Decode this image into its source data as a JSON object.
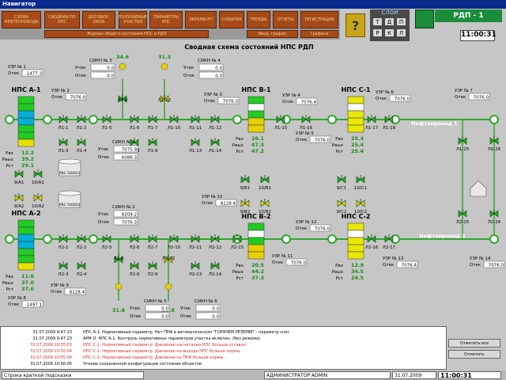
{
  "window": {
    "title": "Навигатор"
  },
  "nav": {
    "top": [
      "СХЕМА НЕФТЕПРОВОДА",
      "СВОДНАЯ ПО НПС",
      "ДОГОВОР. ОКНА",
      "ПОЛУЧАЕМЫЕ УЧАСТКИ",
      "ПАРАМЕТРЫ НПС",
      "ЭКРАНЫ РП",
      "СОБЫТИЯ",
      "ТРЕНДЫ",
      "ОТЧЕТЫ",
      "РЕГИСТРАЦИЯ"
    ],
    "bottom": [
      "Журнал общего состояния НПС и РДП",
      "Ввод. график",
      "Графики"
    ]
  },
  "help": {
    "label": "?"
  },
  "kpanel": {
    "title": "СЛОИ",
    "cells": [
      "Т",
      "Д",
      "П",
      "Р",
      "К",
      "Л"
    ]
  },
  "header": {
    "rdp": "РДП - 1",
    "clock": "11:00:31"
  },
  "schema": {
    "title": "Сводная схема состояний НПС РДП"
  },
  "stations": [
    {
      "name": "НПС А-1",
      "rows": [
        [
          "Рвх",
          "12.2"
        ],
        [
          "Рвых",
          "39.2"
        ],
        [
          "Рст",
          "29.1"
        ]
      ]
    },
    {
      "name": "НПС А-2",
      "rows": [
        [
          "Рвх",
          "11.6"
        ],
        [
          "Рвых",
          "37.0"
        ],
        [
          "Рст",
          "37.0"
        ]
      ]
    },
    {
      "name": "НПС В-1",
      "rows": [
        [
          "Рвх",
          "26.1"
        ],
        [
          "Рвых",
          "47.3"
        ],
        [
          "Рст",
          "47.2"
        ]
      ]
    },
    {
      "name": "НПС В-2",
      "rows": [
        [
          "Рвх",
          "20.5"
        ],
        [
          "Рвых",
          "44.2"
        ],
        [
          "Рст",
          "37.3"
        ]
      ]
    },
    {
      "name": "НПС С-1",
      "rows": [
        [
          "Рвх",
          "25.4"
        ],
        [
          "Рвых",
          "25.4"
        ],
        [
          "Рст",
          "25.4"
        ]
      ]
    },
    {
      "name": "НПС С-2",
      "rows": [
        [
          "Рвх",
          "12.9"
        ],
        [
          "Рвых",
          "34.5"
        ],
        [
          "Рст",
          "24.5"
        ]
      ]
    }
  ],
  "uzr": [
    {
      "name": "УЗР № 1",
      "val": "1477.3"
    },
    {
      "name": "УЗР № 2",
      "val": "7076.0"
    },
    {
      "name": "УЗР № 3",
      "val": "7076.3"
    },
    {
      "name": "УЗР № 4",
      "val": "7076.4"
    },
    {
      "name": "УЗР № 5",
      "val": "7076.0"
    },
    {
      "name": "УЗР № 6",
      "val": "7076.0"
    },
    {
      "name": "УЗР № 7",
      "val": "7076.0"
    },
    {
      "name": "УЗР № 8",
      "val": "1497.1"
    },
    {
      "name": "УЗР № 9",
      "val": "8228.4"
    },
    {
      "name": "УЗР № 10",
      "val": "8228.4"
    },
    {
      "name": "УЗР № 11",
      "val": "7076.0"
    },
    {
      "name": "УЗР № 12",
      "val": "7076.0"
    },
    {
      "name": "УЗР № 13",
      "val": "7076.4"
    },
    {
      "name": "УЗР № 14",
      "val": "7076.0"
    }
  ],
  "siku": [
    {
      "name": "СИКН № 3",
      "k1": "Утек",
      "v1": "0.0",
      "k2": "Отек",
      "v2": "0.0"
    },
    {
      "name": "СИКН № 4",
      "k1": "Утек",
      "v1": "0.0",
      "k2": "Отек",
      "v2": "0.0"
    },
    {
      "name": "СИКН № 1",
      "k1": "Утек",
      "v1": "7075.9",
      "k2": "Отек",
      "v2": "6086.3"
    },
    {
      "name": "СИКН № 2",
      "k1": "Утек",
      "v1": "8209.2",
      "k2": "Отек",
      "v2": "7076.3"
    },
    {
      "name": "СИКН № 5",
      "k1": "Утек",
      "v1": "0.0",
      "k2": "Отек",
      "v2": "0.0"
    },
    {
      "name": "СИКН № 6",
      "k1": "Утек",
      "v1": "0.0",
      "k2": "Отек",
      "v2": "0.0"
    }
  ],
  "pressures": [
    "34.6",
    "31.3",
    "31.6",
    "29.8"
  ],
  "pipes": [
    "Нефтепровод 1",
    "Нефтепровод 2"
  ],
  "tanks": [
    "РВС-5000/3",
    "РВС-5000/4"
  ],
  "valves": {
    "top": [
      "Л1-1",
      "Л1-2",
      "Л1-3",
      "Л1-4",
      "Л1-5",
      "Л1-6",
      "Л1-7",
      "Л1-8",
      "Л1-9",
      "Л1-10",
      "Л1-11",
      "Л1-12",
      "Л1-13",
      "Л1-14",
      "Л1-15",
      "Л1-16",
      "Л1-17",
      "Л1-18",
      "Л1-19",
      "Л1-20",
      "Л1-25",
      "Л1-26"
    ],
    "bottom": [
      "Л2-1",
      "Л2-2",
      "Л2-3",
      "Л2-4",
      "Л2-5",
      "Л2-6",
      "Л2-7",
      "Л2-8",
      "Л2-9",
      "Л2-10",
      "Л2-11",
      "Л2-12",
      "Л2-13",
      "Л2-14",
      "Л2-15",
      "Л2-16",
      "Л2-17",
      "Л2-18",
      "Л2-19",
      "Л2-20",
      "Л2-25",
      "Л2-26"
    ],
    "side": [
      "9/А1",
      "10/А1",
      "9/А2",
      "10/А2",
      "9/В1",
      "10/В1",
      "9/В2",
      "10/В2",
      "9/С1",
      "10/С1",
      "9/С2",
      "10/С2"
    ]
  },
  "log": [
    {
      "time": "31.07.2009 9:47:23",
      "text": "НПС А-1. Нормативный параметр. Нет ПНА в автоматическом \"ГОРЯЧЕМ РЕЗЕРВЕ\" - параметр снят",
      "color": "#000000"
    },
    {
      "time": "31.07.2009 9:47:23",
      "text": "АРМ О: НПС А-1. Контроль нормативных параметров участка включен. (без режима)",
      "color": "#000000"
    },
    {
      "time": "31.07.2009 10:55:03",
      "text": "НПС С-1. Нормативный параметр. Давление нагнетания НПС больше уставки",
      "color": "#d03030"
    },
    {
      "time": "31.07.2009 10:55:04",
      "text": "НПС С-1. Нормативный параметр. Давление на выходе НПС больше нормы",
      "color": "#d03030"
    },
    {
      "time": "31.07.2009 10:55:04",
      "text": "НПС С-1. Нормативный параметр. Давление на ПНА больше нормы",
      "color": "#d03030"
    },
    {
      "time": "31.07.2009 10:56:05",
      "text": "Чтение сохраненной конфигурации состояния объектов",
      "color": "#000000"
    }
  ],
  "side_buttons": [
    "Отметить все",
    "Отметить"
  ],
  "statusbar": {
    "hint": "Строка краткой подсказки",
    "user": "АДМИНИСТРАТОР  ADMIN",
    "date": "31.07.2009",
    "time": "11:00:31"
  },
  "colors": {
    "line_green": "#2ea82e",
    "valve_green": "#22aa22",
    "valve_yellow": "#e8d000",
    "nav_button": "#a84a18",
    "title_bar": "#0a2a8c"
  }
}
